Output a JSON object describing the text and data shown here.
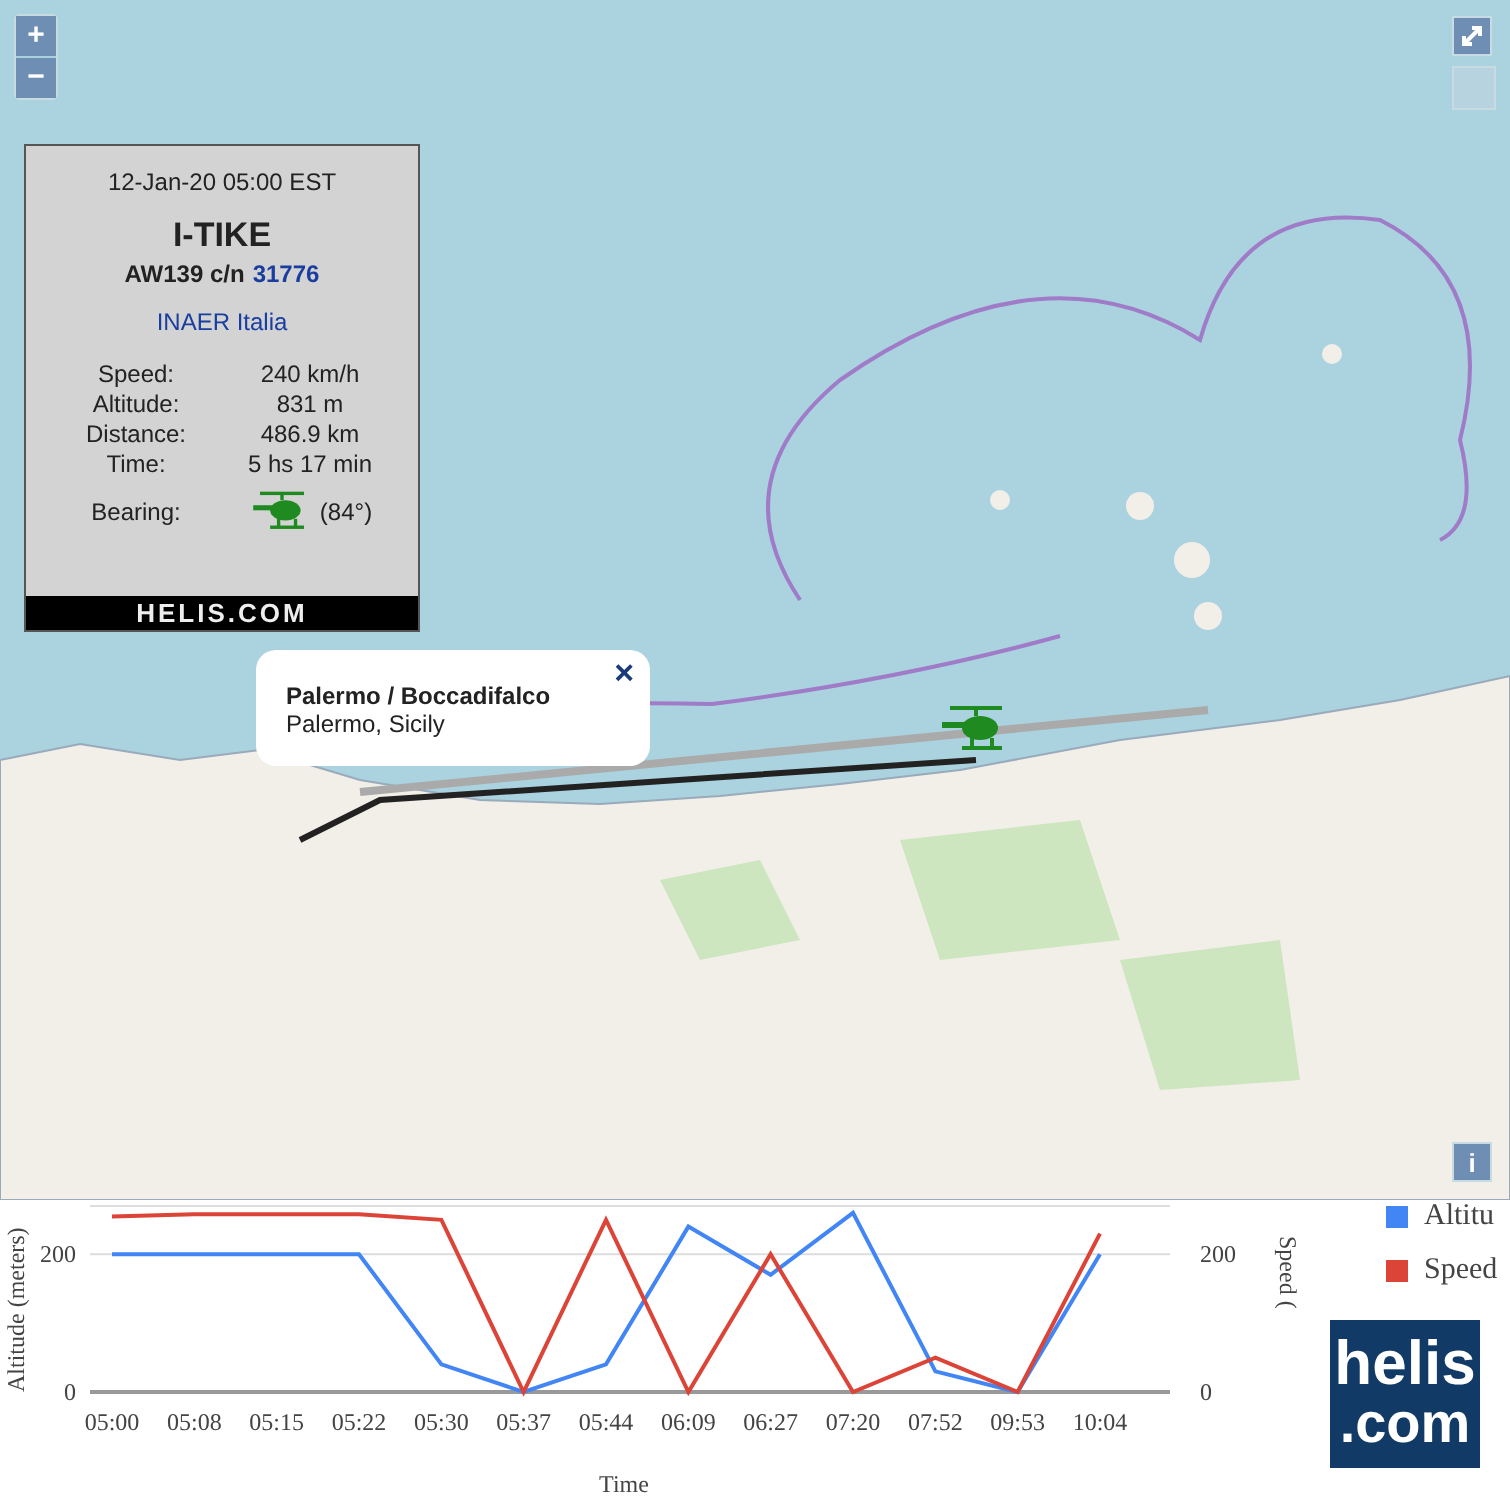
{
  "map": {
    "zoom_in": "+",
    "zoom_out": "−",
    "info_button": "i"
  },
  "info_panel": {
    "datetime": "12-Jan-20 05:00 EST",
    "registration": "I-TIKE",
    "model": "AW139 c/n",
    "serial": "31776",
    "operator": "INAER Italia",
    "stats": [
      {
        "label": "Speed:",
        "value": "240 km/h"
      },
      {
        "label": "Altitude:",
        "value": "831 m"
      },
      {
        "label": "Distance:",
        "value": "486.9 km"
      },
      {
        "label": "Time:",
        "value": "5 hs 17 min"
      }
    ],
    "bearing_label": "Bearing:",
    "bearing_value": "(84°)",
    "footer": "HELIS.COM"
  },
  "popup": {
    "title": "Palermo / Boccadifalco",
    "subtitle": "Palermo, Sicily",
    "close": "×"
  },
  "chart_data": {
    "type": "line",
    "xlabel": "Time",
    "ylabel": "Altitude (meters)",
    "y2label": "Speed (",
    "categories": [
      "05:00",
      "05:08",
      "05:15",
      "05:22",
      "05:30",
      "05:37",
      "05:44",
      "06:09",
      "06:27",
      "07:20",
      "07:52",
      "09:53",
      "10:04"
    ],
    "series": [
      {
        "name": "Altitu",
        "color": "#4285f4",
        "values": [
          200,
          200,
          200,
          200,
          40,
          0,
          40,
          240,
          170,
          260,
          30,
          0,
          200
        ]
      },
      {
        "name": "Speed",
        "color": "#db4437",
        "values": [
          255,
          258,
          258,
          258,
          250,
          0,
          250,
          0,
          200,
          0,
          50,
          0,
          230
        ]
      }
    ],
    "ylim": [
      0,
      270
    ],
    "yticks": [
      0,
      200
    ],
    "y2lim": [
      0,
      270
    ],
    "y2ticks": [
      0,
      200
    ]
  },
  "logo": {
    "line1": "helis",
    "line2": ".com"
  }
}
